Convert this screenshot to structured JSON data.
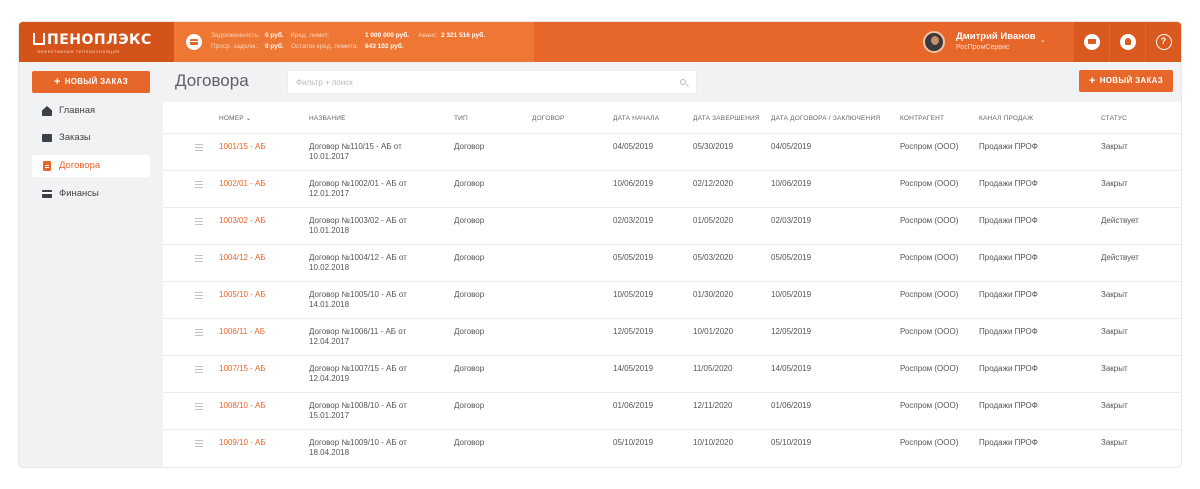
{
  "brand": {
    "name": "ПЕНОПЛЭКС",
    "tagline": "ЭФФЕКТИВНАЯ ТЕПЛОИЗОЛЯЦИЯ"
  },
  "credit": {
    "debt_label": "Задолженность:",
    "debt_value": "0 руб.",
    "limit_label": "Кред. лимит:",
    "limit_value": "1 000 000 руб.",
    "advance_label": "Аванс:",
    "advance_value": "2 321 516 руб.",
    "overdue_label": "Проср. задолж.:",
    "overdue_value": "0 руб.",
    "remaining_label": "Остаток кред. лимита:",
    "remaining_value": "643 102 руб."
  },
  "user": {
    "name": "Дмитрий Иванов",
    "company": "РосПромСервис"
  },
  "sidebar": {
    "new_order": "НОВЫЙ ЗАКАЗ",
    "items": [
      {
        "label": "Главная",
        "icon": "home-icon"
      },
      {
        "label": "Заказы",
        "icon": "briefcase-icon"
      },
      {
        "label": "Договора",
        "icon": "document-icon"
      },
      {
        "label": "Финансы",
        "icon": "card-icon"
      }
    ]
  },
  "main": {
    "title": "Договора",
    "search_placeholder": "Фильтр + поиск",
    "new_order": "НОВЫЙ ЗАКАЗ"
  },
  "columns": [
    "НОМЕР",
    "НАЗВАНИЕ",
    "ТИП",
    "ДОГОВОР",
    "ДАТА НАЧАЛА",
    "ДАТА ЗАВЕРШЕНИЯ",
    "ДАТА ДОГОВОРА / ЗАКЛЮЧЕНИЯ",
    "КОНТРАГЕНТ",
    "КАНАЛ ПРОДАЖ",
    "СТАТУС"
  ],
  "rows": [
    {
      "number": "1001/15 - АБ",
      "name": "Договор №110/15 - АБ от 10.01.2017",
      "type": "Договор",
      "contract": "",
      "start": "04/05/2019",
      "end": "05/30/2019",
      "concluded": "04/05/2019",
      "counterparty": "Роспром (ООО)",
      "channel": "Продажи ПРОФ",
      "status": "Закрыт"
    },
    {
      "number": "1002/01 - АБ",
      "name": "Договор №1002/01 - АБ от 12.01.2017",
      "type": "Договор",
      "contract": "",
      "start": "10/06/2019",
      "end": "02/12/2020",
      "concluded": "10/06/2019",
      "counterparty": "Роспром (ООО)",
      "channel": "Продажи ПРОФ",
      "status": "Закрыт"
    },
    {
      "number": "1003/02 - АБ",
      "name": "Договор №1003/02 - АБ от 10.01.2018",
      "type": "Договор",
      "contract": "",
      "start": "02/03/2019",
      "end": "01/05/2020",
      "concluded": "02/03/2019",
      "counterparty": "Роспром (ООО)",
      "channel": "Продажи ПРОФ",
      "status": "Действует"
    },
    {
      "number": "1004/12 - АБ",
      "name": "Договор №1004/12 - АБ от 10.02.2018",
      "type": "Договор",
      "contract": "",
      "start": "05/05/2019",
      "end": "05/03/2020",
      "concluded": "05/05/2019",
      "counterparty": "Роспром (ООО)",
      "channel": "Продажи ПРОФ",
      "status": "Действует"
    },
    {
      "number": "1005/10 - АБ",
      "name": "Договор №1005/10 - АБ от 14.01.2018",
      "type": "Договор",
      "contract": "",
      "start": "10/05/2019",
      "end": "01/30/2020",
      "concluded": "10/05/2019",
      "counterparty": "Роспром (ООО)",
      "channel": "Продажи ПРОФ",
      "status": "Закрыт"
    },
    {
      "number": "1006/11 - АБ",
      "name": "Договор №1006/11 - АБ от 12.04.2017",
      "type": "Договор",
      "contract": "",
      "start": "12/05/2019",
      "end": "10/01/2020",
      "concluded": "12/05/2019",
      "counterparty": "Роспром (ООО)",
      "channel": "Продажи ПРОФ",
      "status": "Закрыт"
    },
    {
      "number": "1007/15 - АБ",
      "name": "Договор №1007/15 - АБ от 12.04.2019",
      "type": "Договор",
      "contract": "",
      "start": "14/05/2019",
      "end": "11/05/2020",
      "concluded": "14/05/2019",
      "counterparty": "Роспром (ООО)",
      "channel": "Продажи ПРОФ",
      "status": "Закрыт"
    },
    {
      "number": "1008/10 - АБ",
      "name": "Договор №1008/10 - АБ от 15.01.2017",
      "type": "Договор",
      "contract": "",
      "start": "01/06/2019",
      "end": "12/11/2020",
      "concluded": "01/06/2019",
      "counterparty": "Роспром (ООО)",
      "channel": "Продажи ПРОФ",
      "status": "Закрыт"
    },
    {
      "number": "1009/10 - АБ",
      "name": "Договор №1009/10 - АБ от 18.04.2018",
      "type": "Договор",
      "contract": "",
      "start": "05/10/2019",
      "end": "10/10/2020",
      "concluded": "05/10/2019",
      "counterparty": "Роспром (ООО)",
      "channel": "Продажи ПРОФ",
      "status": "Закрыт"
    }
  ],
  "colors": {
    "accent": "#e7662a",
    "accent_dark": "#d4531b",
    "background": "#f1f2f4",
    "text": "#555555"
  },
  "icons": {
    "sort": "chevron-down-icon",
    "row_handle": "drag-handle-icon",
    "chat": "chat-icon",
    "notifications": "bell-icon",
    "help": "help-icon"
  }
}
